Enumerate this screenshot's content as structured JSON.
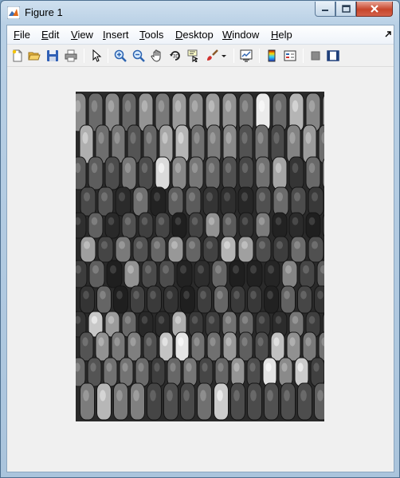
{
  "window": {
    "title": "Figure 1",
    "colors": {
      "titlebar": "#b9d0e5",
      "client": "#f0f0f0",
      "close": "#c7452b"
    }
  },
  "menu": {
    "items": [
      {
        "key": "file",
        "prefix": "",
        "underline": "F",
        "rest": "ile"
      },
      {
        "key": "edit",
        "prefix": "",
        "underline": "E",
        "rest": "dit"
      },
      {
        "key": "view",
        "prefix": "",
        "underline": "V",
        "rest": "iew"
      },
      {
        "key": "insert",
        "prefix": "",
        "underline": "I",
        "rest": "nsert"
      },
      {
        "key": "tools",
        "prefix": "",
        "underline": "T",
        "rest": "ools"
      },
      {
        "key": "desktop",
        "prefix": "",
        "underline": "D",
        "rest": "esktop"
      },
      {
        "key": "window",
        "prefix": "",
        "underline": "W",
        "rest": "indow"
      },
      {
        "key": "help",
        "prefix": "",
        "underline": "H",
        "rest": "elp"
      }
    ]
  },
  "toolbar": {
    "icons": [
      "new-figure-icon",
      "open-file-icon",
      "save-icon",
      "print-icon",
      "pointer-icon",
      "zoom-in-icon",
      "zoom-out-icon",
      "pan-hand-icon",
      "rotate-3d-icon",
      "data-cursor-icon",
      "brush-icon",
      "brush-dropdown-icon",
      "link-plot-icon",
      "colorbar-icon",
      "legend-icon",
      "hide-plot-tools-icon",
      "show-plot-tools-icon"
    ]
  },
  "figure": {
    "image": "grayscale photograph of corn cobs"
  }
}
